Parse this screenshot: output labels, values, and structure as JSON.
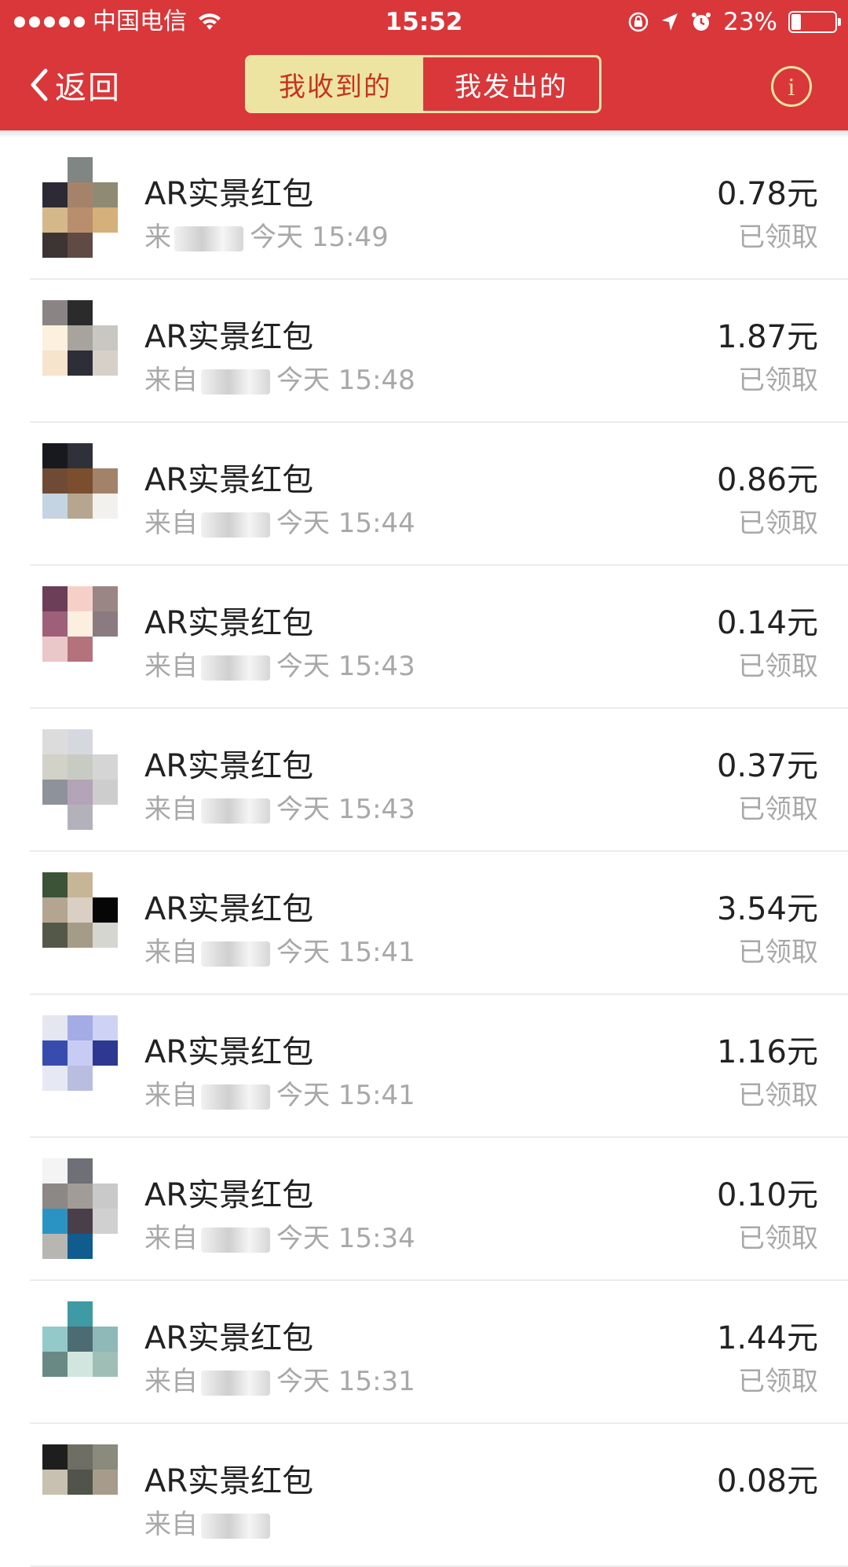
{
  "status_bar": {
    "carrier": "中国电信",
    "time": "15:52",
    "battery": "23%",
    "battery_level": 0.23
  },
  "nav": {
    "back_label": "返回",
    "tabs": [
      {
        "label": "我收到的",
        "active": true
      },
      {
        "label": "我发出的",
        "active": false
      }
    ],
    "info_glyph": "i"
  },
  "colors": {
    "header_red": "#d9373a",
    "tab_active_bg": "#ede4a2",
    "tab_active_text": "#c7321f",
    "text_primary": "#222222",
    "text_secondary": "#a8a8a8"
  },
  "items": [
    {
      "title": "AR实景红包",
      "from": "来",
      "time": "今天 15:49",
      "amount": "0.78元",
      "status": "已领取",
      "avatar": [
        "#ffffff",
        "#7f8684",
        "#ffffff",
        "#2d2a35",
        "#a5836a",
        "#8f8a73",
        "#d4b88a",
        "#b88e6d",
        "#d5b07a",
        "#3d3534",
        "#5f4b44",
        "#ffffff"
      ]
    },
    {
      "title": "AR实景红包",
      "from": "来自",
      "time": "今天 15:48",
      "amount": "1.87元",
      "status": "已领取",
      "avatar": [
        "#8a8484",
        "#2b2b2b",
        "#ffffff",
        "#fbf1de",
        "#a8a39d",
        "#c9c7c2",
        "#f7e4cc",
        "#2d2e38",
        "#d6d0c8",
        "#ffffff",
        "#ffffff",
        "#ffffff"
      ]
    },
    {
      "title": "AR实景红包",
      "from": "来自",
      "time": "今天 15:44",
      "amount": "0.86元",
      "status": "已领取",
      "avatar": [
        "#17191f",
        "#2e3139",
        "#ffffff",
        "#6f4b35",
        "#7a4e2e",
        "#a2836a",
        "#c5d4e2",
        "#b6a690",
        "#f3f1ee",
        "#ffffff",
        "#ffffff",
        "#ffffff"
      ]
    },
    {
      "title": "AR实景红包",
      "from": "来自",
      "time": "今天 15:43",
      "amount": "0.14元",
      "status": "已领取",
      "avatar": [
        "#6c3e57",
        "#f6d0c8",
        "#9a8684",
        "#9e6078",
        "#fcefe0",
        "#8b7a80",
        "#eac7c8",
        "#b4727d",
        "#ffffff",
        "#ffffff",
        "#ffffff",
        "#ffffff"
      ]
    },
    {
      "title": "AR实景红包",
      "from": "来自",
      "time": "今天 15:43",
      "amount": "0.37元",
      "status": "已领取",
      "avatar": [
        "#dcdcdc",
        "#d5d9df",
        "#ffffff",
        "#d2d2c8",
        "#c8cbc2",
        "#d5d5d5",
        "#8e929a",
        "#b3a4b8",
        "#cdcdcd",
        "#ffffff",
        "#b3b2bb",
        "#ffffff"
      ]
    },
    {
      "title": "AR实景红包",
      "from": "来自",
      "time": "今天 15:41",
      "amount": "3.54元",
      "status": "已领取",
      "avatar": [
        "#3d5338",
        "#c6b596",
        "#ffffff",
        "#b4a591",
        "#d9cfc3",
        "#060606",
        "#545848",
        "#a49c87",
        "#d6d6d0",
        "#ffffff",
        "#ffffff",
        "#ffffff"
      ]
    },
    {
      "title": "AR实景红包",
      "from": "来自",
      "time": "今天 15:41",
      "amount": "1.16元",
      "status": "已领取",
      "avatar": [
        "#e4e6f0",
        "#a4ace5",
        "#ced3f5",
        "#384cb0",
        "#c8ccf4",
        "#2e3890",
        "#e6e8f4",
        "#b9bde0",
        "#ffffff",
        "#ffffff",
        "#ffffff",
        "#ffffff"
      ]
    },
    {
      "title": "AR实景红包",
      "from": "来自",
      "time": "今天 15:34",
      "amount": "0.10元",
      "status": "已领取",
      "avatar": [
        "#f4f4f4",
        "#6f6f78",
        "#ffffff",
        "#8b8885",
        "#a19c97",
        "#c9c9c9",
        "#2b93c4",
        "#4a3e4a",
        "#d0d0d0",
        "#b8b6b3",
        "#105c8e",
        "#ffffff"
      ]
    },
    {
      "title": "AR实景红包",
      "from": "来自",
      "time": "今天 15:31",
      "amount": "1.44元",
      "status": "已领取",
      "avatar": [
        "#ffffff",
        "#3e9aa4",
        "#ffffff",
        "#93c9c9",
        "#4d6b73",
        "#8fb8b8",
        "#698a84",
        "#d2e6df",
        "#9fbfb6",
        "#ffffff",
        "#ffffff",
        "#ffffff"
      ]
    },
    {
      "title": "AR实景红包",
      "from": "来自",
      "time": "",
      "amount": "0.08元",
      "status": "",
      "avatar": [
        "#1e1e1e",
        "#6f6e64",
        "#8a8a7d",
        "#c8c0b0",
        "#50544a",
        "#a79c8b",
        "#ffffff",
        "#ffffff",
        "#ffffff",
        "#ffffff",
        "#ffffff",
        "#ffffff"
      ]
    }
  ]
}
